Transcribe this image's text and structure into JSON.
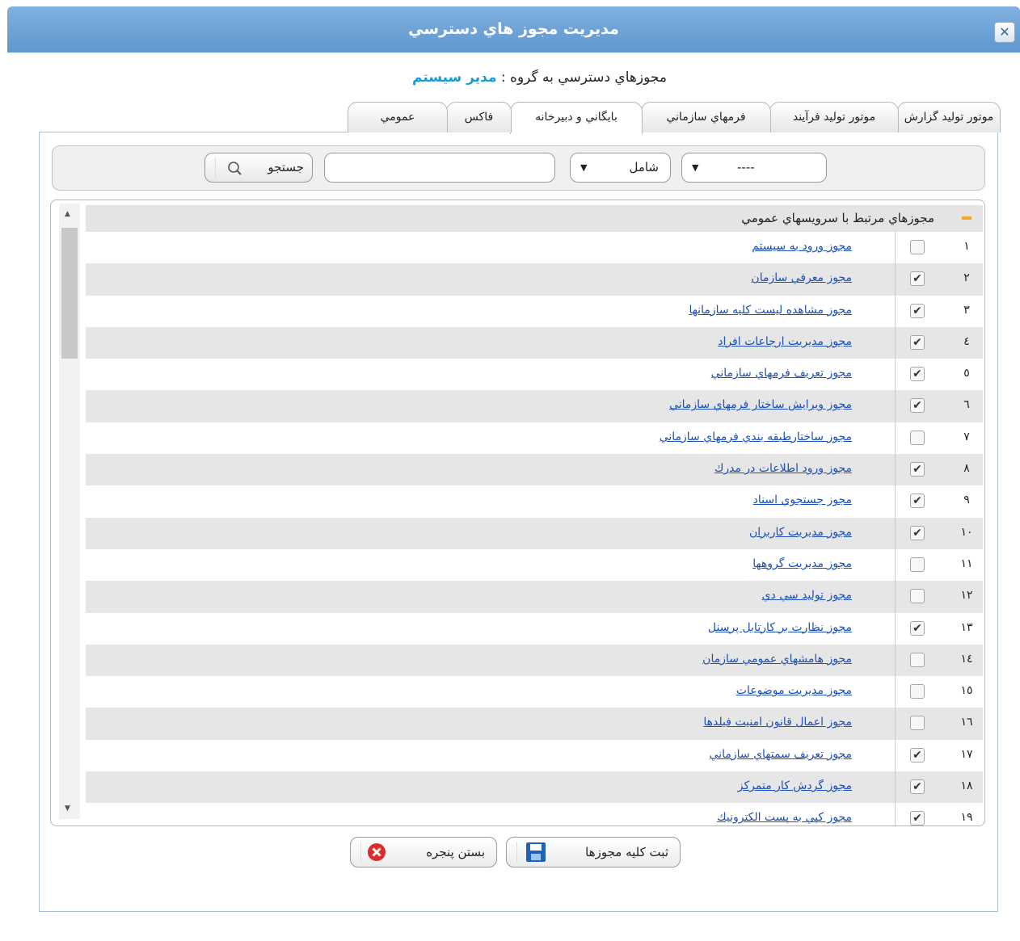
{
  "window": {
    "title": "مديريت مجوز هاي دسترسي"
  },
  "subtitle": {
    "prefix": "مجوزهاي دسترسي به گروه :",
    "group": "مدير سيستم"
  },
  "tabs": [
    {
      "label": "موتور توليد گزارش"
    },
    {
      "label": "موتور توليد فرآيند"
    },
    {
      "label": "فرمهاي سازماني"
    },
    {
      "label": "بايگاني و دبيرخانه"
    },
    {
      "label": "فاكس"
    },
    {
      "label": "عمومي"
    }
  ],
  "search": {
    "field_value": "----",
    "operator_value": "شامل",
    "input_value": "",
    "button_label": "جستجو"
  },
  "group": {
    "label": "مجوزهاي مرتبط با سرويسهاي عمومي"
  },
  "rows": [
    {
      "num": "١",
      "checked": false,
      "label": "مجوز ورود به سيستم"
    },
    {
      "num": "٢",
      "checked": true,
      "label": "مجوز معرفي سازمان"
    },
    {
      "num": "٣",
      "checked": true,
      "label": "مجوز مشاهده ليست كليه سازمانها"
    },
    {
      "num": "٤",
      "checked": true,
      "label": "مجوز مديريت ارجاعات افراد"
    },
    {
      "num": "٥",
      "checked": true,
      "label": "مجوز تعريف فرمهاي سازماني"
    },
    {
      "num": "٦",
      "checked": true,
      "label": "مجوز ويرايش ساختار فرمهاي سازماني"
    },
    {
      "num": "٧",
      "checked": false,
      "label": "مجوز ساختارطبقه بندي فرمهاي سازماني"
    },
    {
      "num": "٨",
      "checked": true,
      "label": "مجوز ورود اطلاعات در مدرك"
    },
    {
      "num": "٩",
      "checked": true,
      "label": "مجوز جستجوي اسناد"
    },
    {
      "num": "١٠",
      "checked": true,
      "label": "مجوز مديريت كاربران"
    },
    {
      "num": "١١",
      "checked": false,
      "label": "مجوز مديريت گروهها"
    },
    {
      "num": "١٢",
      "checked": false,
      "label": "مجوز توليد سي دي"
    },
    {
      "num": "١٣",
      "checked": true,
      "label": "مجوز نظارت بر كارتابل پرسنل"
    },
    {
      "num": "١٤",
      "checked": false,
      "label": "مجوز هامشهاي عمومي سازمان"
    },
    {
      "num": "١٥",
      "checked": false,
      "label": "مجوز مديريت موضوعات"
    },
    {
      "num": "١٦",
      "checked": false,
      "label": "مجوز اعمال قانون امنيت فيلدها"
    },
    {
      "num": "١٧",
      "checked": true,
      "label": "مجوز تعريف سمتهاي سازماني"
    },
    {
      "num": "١٨",
      "checked": true,
      "label": "مجوز گردش كار متمركز"
    },
    {
      "num": "١٩",
      "checked": true,
      "label": "مجوز كپي به پست الكترونيك"
    }
  ],
  "buttons": {
    "save_label": "ثبت كليه مجوزها",
    "close_label": "بستن پنجره"
  },
  "colors": {
    "title_bar": "#6aa2d8",
    "link": "#1d4fb8",
    "accent": "#1a9ad6"
  }
}
